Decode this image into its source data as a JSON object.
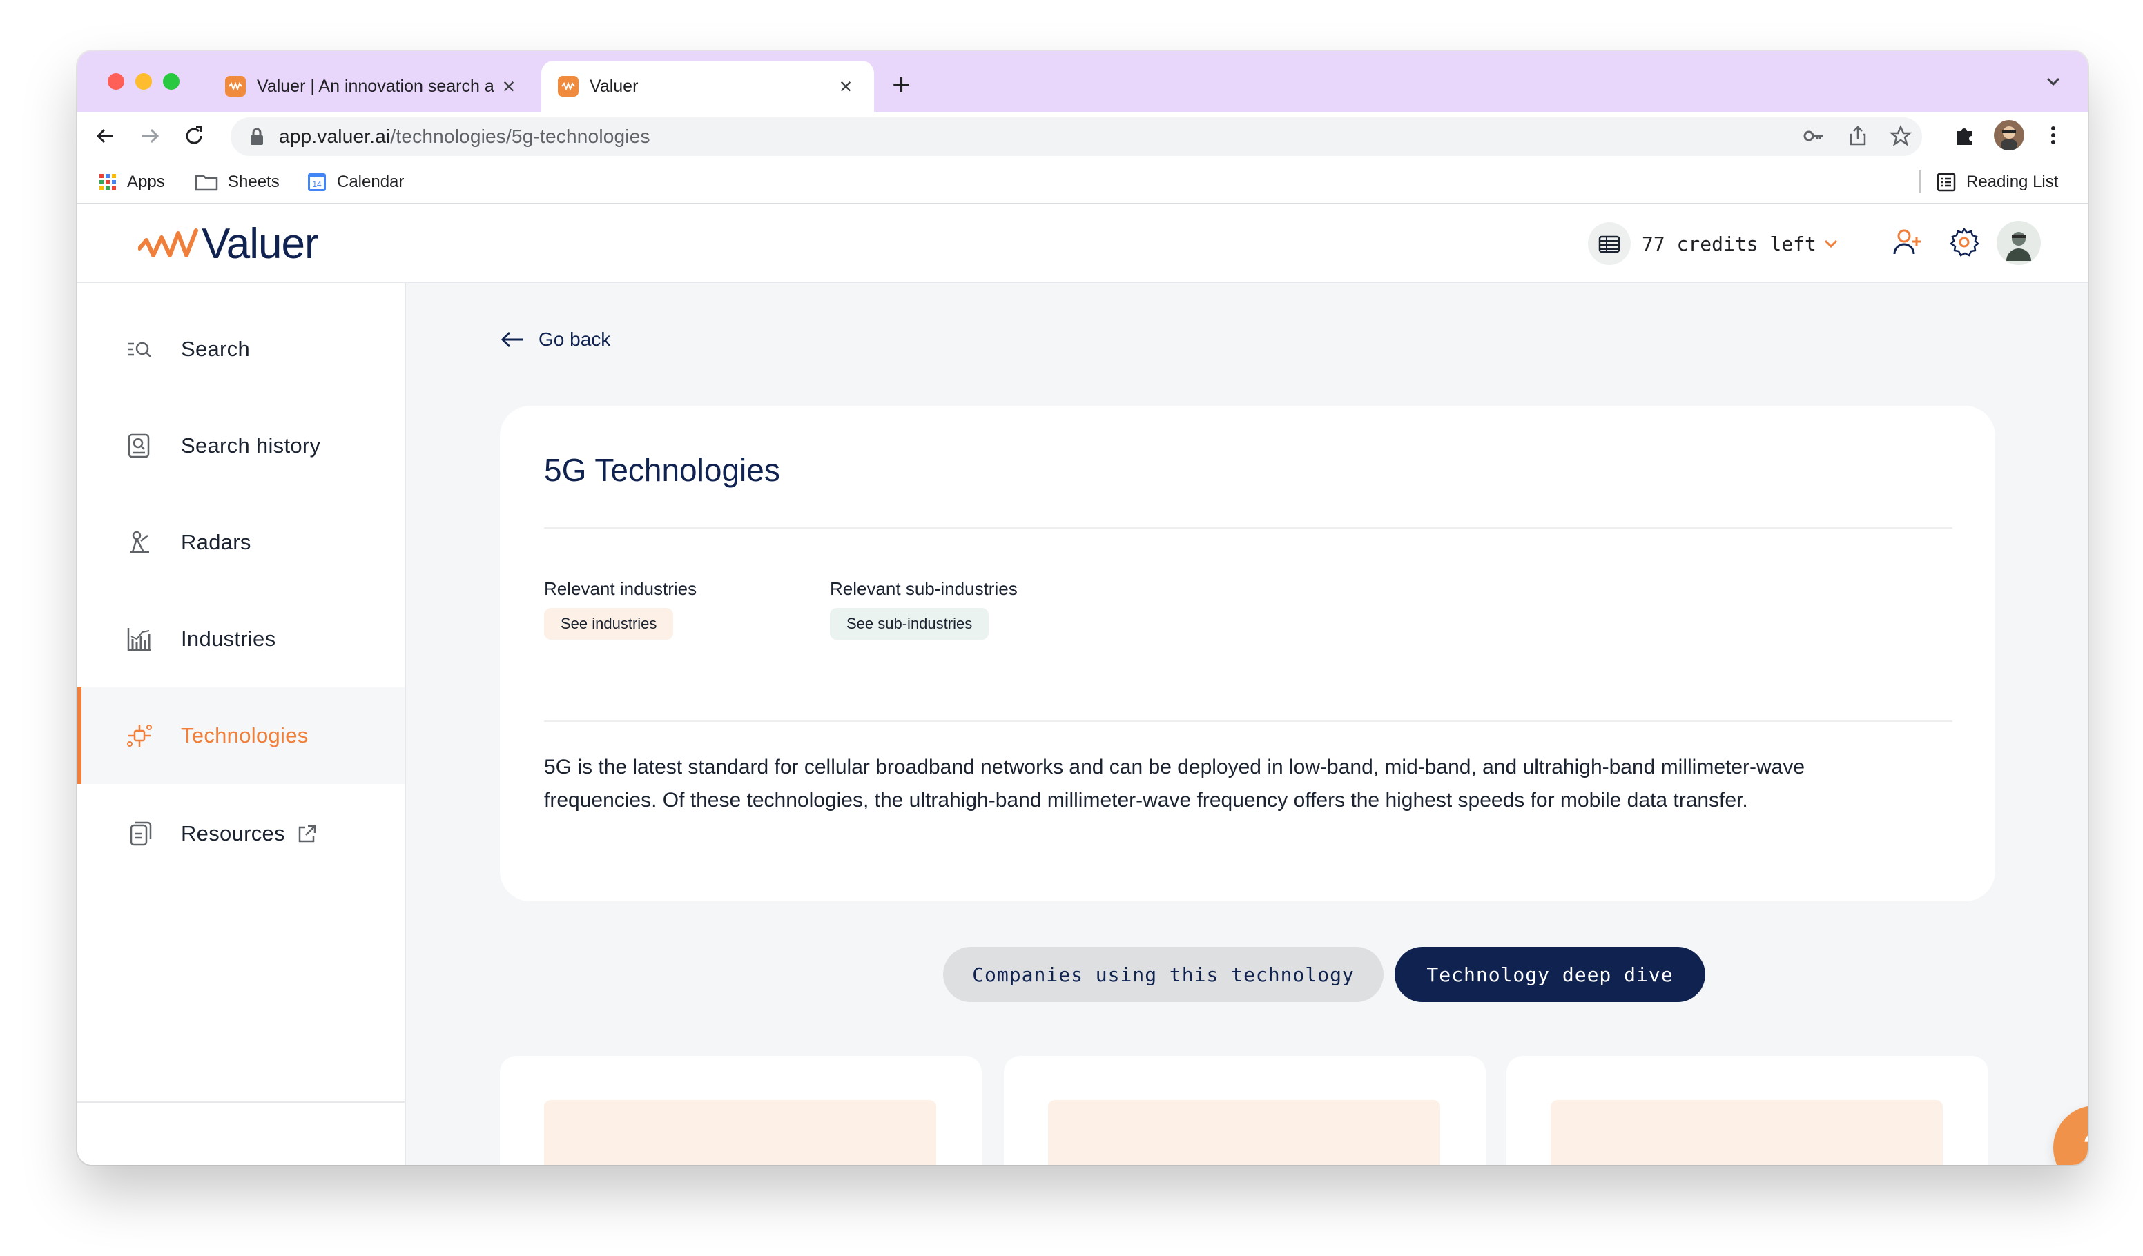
{
  "browser": {
    "tabs": [
      {
        "title": "Valuer | An innovation search a",
        "active": false
      },
      {
        "title": "Valuer",
        "active": true
      }
    ],
    "url_host": "app.valuer.ai",
    "url_path": "/technologies/5g-technologies",
    "bookmarks": [
      {
        "label": "Apps",
        "icon": "apps-grid-icon"
      },
      {
        "label": "Sheets",
        "icon": "folder-icon"
      },
      {
        "label": "Calendar",
        "icon": "calendar-icon"
      }
    ],
    "calendar_day": "14",
    "reading_list": "Reading List"
  },
  "app": {
    "logo_text": "Valuer",
    "credits_text": "77 credits left",
    "accent": "#ef7f3a",
    "navy": "#0f2250"
  },
  "sidebar": {
    "items": [
      {
        "label": "Search",
        "icon": "search-icon"
      },
      {
        "label": "Search history",
        "icon": "search-history-icon"
      },
      {
        "label": "Radars",
        "icon": "radar-icon"
      },
      {
        "label": "Industries",
        "icon": "industries-chart-icon"
      },
      {
        "label": "Technologies",
        "icon": "technologies-icon",
        "active": true
      },
      {
        "label": "Resources",
        "icon": "resources-icon",
        "external": true
      }
    ]
  },
  "main": {
    "go_back": "Go back",
    "title": "5G Technologies",
    "relevant_industries_label": "Relevant industries",
    "see_industries": "See industries",
    "relevant_sub_industries_label": "Relevant sub-industries",
    "see_sub_industries": "See sub-industries",
    "description": "5G is the latest standard for cellular broadband networks and can be deployed in low-band, mid-band, and ultrahigh-band millimeter-wave frequencies. Of these technologies, the ultrahigh-band millimeter-wave frequency offers the highest speeds for mobile data transfer.",
    "tab_companies": "Companies using this technology",
    "tab_deep_dive": "Technology deep dive"
  },
  "help_label": "?"
}
